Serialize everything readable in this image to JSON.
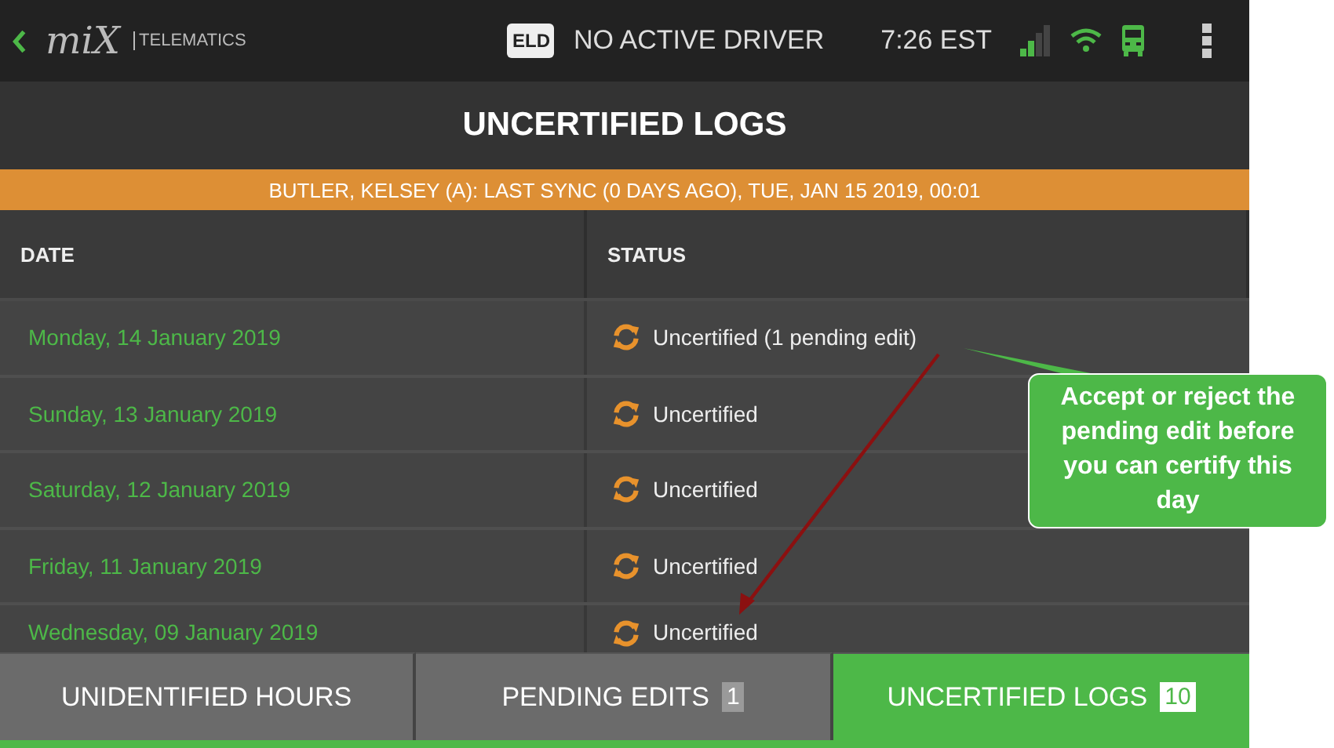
{
  "header": {
    "brand": "miX",
    "brand_suffix": "TELEMATICS",
    "eld_badge": "ELD",
    "driver_status": "NO ACTIVE DRIVER",
    "time": "7:26 EST"
  },
  "title": "UNCERTIFIED LOGS",
  "sync_banner": "BUTLER, KELSEY (A): LAST SYNC (0 DAYS AGO), TUE, JAN 15 2019, 00:01",
  "table": {
    "columns": [
      "DATE",
      "STATUS"
    ],
    "rows": [
      {
        "date": "Monday, 14 January 2019",
        "status": "Uncertified (1 pending edit)"
      },
      {
        "date": "Sunday, 13 January 2019",
        "status": "Uncertified"
      },
      {
        "date": "Saturday, 12 January 2019",
        "status": "Uncertified"
      },
      {
        "date": "Friday, 11 January 2019",
        "status": "Uncertified"
      },
      {
        "date": "Wednesday, 09 January 2019",
        "status": "Uncertified"
      }
    ]
  },
  "tabs": [
    {
      "label": "UNIDENTIFIED HOURS",
      "selected": false
    },
    {
      "label": "PENDING EDITS",
      "count": "1",
      "selected": false
    },
    {
      "label": "UNCERTIFIED LOGS",
      "count": "10",
      "selected": true
    }
  ],
  "callout": {
    "text": "Accept or reject the pending edit before you can certify this day"
  }
}
